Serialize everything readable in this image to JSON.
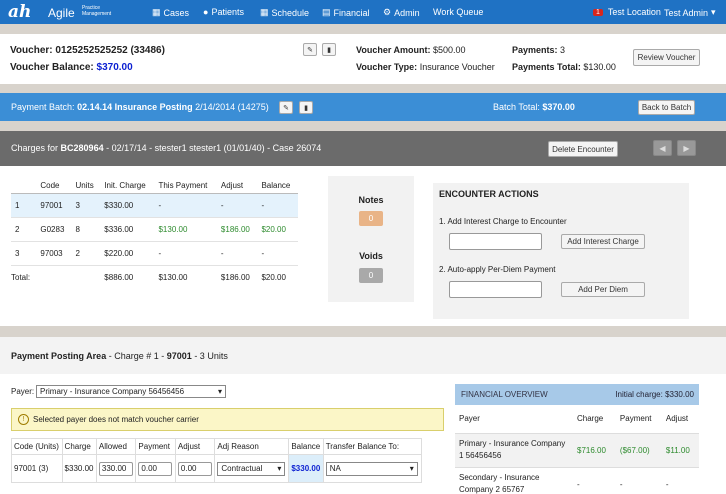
{
  "nav": {
    "logo": "ah",
    "brand": "Agile",
    "brand_sub": "Practice Management",
    "items": [
      "Cases",
      "Patients",
      "Schedule",
      "Financial",
      "Admin",
      "Work Queue"
    ],
    "test_location_count": "1",
    "test_location": "Test Location",
    "user": "Test Admin"
  },
  "voucher": {
    "label": "Voucher:",
    "number": "0125252525252 (33486)",
    "balance_label": "Voucher Balance:",
    "balance": "$370.00",
    "amount_label": "Voucher Amount:",
    "amount": "$500.00",
    "type_label": "Voucher Type:",
    "type": "Insurance Voucher",
    "payments_label": "Payments:",
    "payments": "3",
    "payments_total_label": "Payments Total:",
    "payments_total": "$130.00",
    "review_button": "Review Voucher"
  },
  "batch": {
    "label": "Payment Batch:",
    "name": "02.14.14 Insurance Posting",
    "date": "2/14/2014 (14275)",
    "total_label": "Batch Total:",
    "total": "$370.00",
    "back_button": "Back to Batch"
  },
  "charges": {
    "prefix": "Charges for",
    "encounter": "BC280964",
    "details": "- 02/17/14 - stester1 stester1 (01/01/40) - Case 26074",
    "delete_button": "Delete Encounter",
    "headers": [
      "",
      "Code",
      "Units",
      "Init. Charge",
      "This Payment",
      "Adjust",
      "Balance"
    ],
    "rows": [
      [
        "1",
        "97001",
        "3",
        "$330.00",
        "-",
        "-",
        "-"
      ],
      [
        "2",
        "G0283",
        "8",
        "$336.00",
        "$130.00",
        "$186.00",
        "$20.00"
      ],
      [
        "3",
        "97003",
        "2",
        "$220.00",
        "-",
        "-",
        "-"
      ]
    ],
    "totals": [
      "Total:",
      "",
      "",
      "$886.00",
      "$130.00",
      "$186.00",
      "$20.00"
    ]
  },
  "notes": {
    "label": "Notes",
    "count": "0"
  },
  "voids": {
    "label": "Voids",
    "count": "0"
  },
  "encounter_actions": {
    "title": "ENCOUNTER ACTIONS",
    "interest_label": "1. Add Interest Charge to Encounter",
    "interest_button": "Add Interest Charge",
    "perdiem_label": "2. Auto-apply Per-Diem Payment",
    "perdiem_button": "Add Per Diem"
  },
  "posting": {
    "title": "Payment Posting Area",
    "charge_prefix": "- Charge # 1 -",
    "charge_code": "97001",
    "units": "- 3 Units",
    "payer_label": "Payer:",
    "payer_value": "Primary - Insurance Company 56456456",
    "warning": "Selected payer does not match voucher carrier",
    "headers": [
      "Code (Units)",
      "Charge",
      "Allowed",
      "Payment",
      "Adjust",
      "Adj Reason",
      "Balance",
      "Transfer Balance To:"
    ],
    "row": {
      "code": "97001 (3)",
      "charge": "$330.00",
      "allowed": "330.00",
      "payment": "0.00",
      "adjust": "0.00",
      "reason": "Contractual",
      "balance": "$330.00",
      "transfer": "NA"
    }
  },
  "financial": {
    "title": "FINANCIAL OVERVIEW",
    "initial_charge": "Initial charge: $330.00",
    "headers": [
      "Payer",
      "Charge",
      "Payment",
      "Adjust"
    ],
    "rows": [
      [
        "Primary - Insurance Company 1 56456456",
        "$716.00",
        "($67.00)",
        "$11.00"
      ],
      [
        "Secondary - Insurance Company 2 65767",
        "-",
        "-",
        "-"
      ]
    ]
  }
}
